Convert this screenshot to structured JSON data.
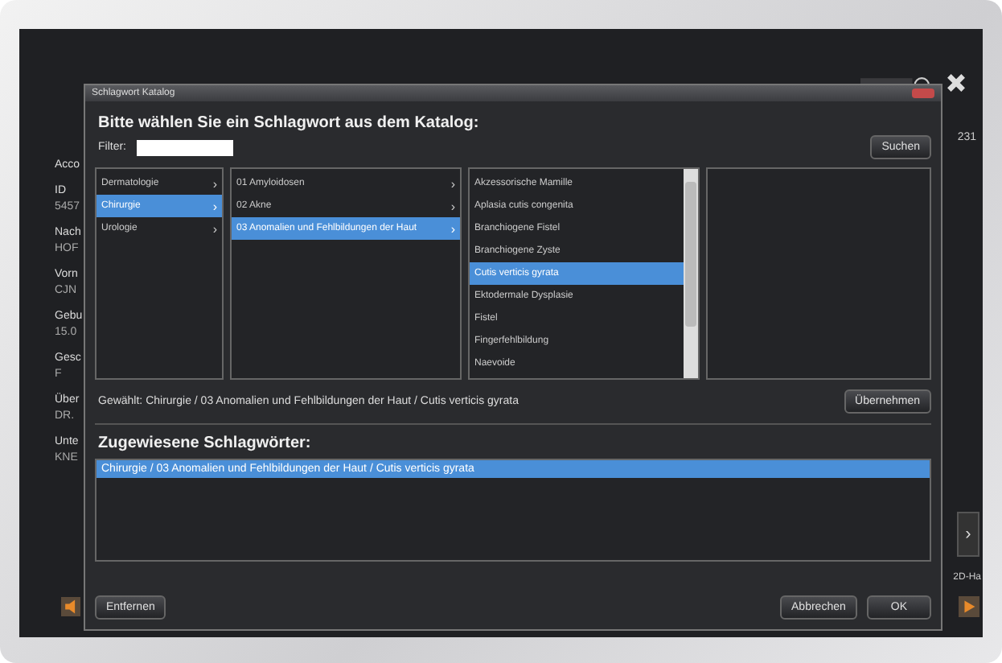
{
  "background_app": {
    "labels": [
      "Acco",
      "ID",
      "5457",
      "Nach",
      "HOF",
      "Vorn",
      "CJN",
      "Gebu",
      "15.0",
      "Gesc",
      "F",
      "Über",
      "DR.",
      "Unte",
      "KNE"
    ],
    "right_text": "231",
    "side_button": "›",
    "corner_text": "2D-Ha"
  },
  "dialog": {
    "title": "Schlagwort Katalog",
    "heading": "Bitte wählen Sie ein Schlagwort aus dem Katalog:",
    "filter_label": "Filter:",
    "search_button": "Suchen",
    "lists": [
      {
        "items": [
          {
            "label": "Dermatologie",
            "arrow": "›",
            "selected": false
          },
          {
            "label": "Chirurgie",
            "arrow": "›",
            "selected": true
          },
          {
            "label": "Urologie",
            "arrow": "›",
            "selected": false
          }
        ]
      },
      {
        "items": [
          {
            "label": "01 Amyloidosen",
            "arrow": "›",
            "selected": false
          },
          {
            "label": "02 Akne",
            "arrow": "›",
            "selected": false
          },
          {
            "label": "03 Anomalien und Fehlbildungen der Haut",
            "arrow": "›",
            "selected": true
          }
        ]
      },
      {
        "scrollbar": true,
        "items": [
          {
            "label": "Akzessorische Mamille",
            "selected": false
          },
          {
            "label": "Aplasia cutis congenita",
            "selected": false
          },
          {
            "label": "Branchiogene Fistel",
            "selected": false
          },
          {
            "label": "Branchiogene Zyste",
            "selected": false
          },
          {
            "label": "Cutis verticis gyrata",
            "selected": true
          },
          {
            "label": "Ektodermale Dysplasie",
            "selected": false
          },
          {
            "label": "Fistel",
            "selected": false
          },
          {
            "label": "Fingerfehlbildung",
            "selected": false
          },
          {
            "label": "Naevoide",
            "selected": false
          }
        ]
      },
      {
        "scrollbar": false
      }
    ],
    "chosen_label": "Gewählt:",
    "chosen_value": "Chirurgie / 03 Anomalien und Fehlbildungen der Haut / Cutis verticis gyrata",
    "apply_button": "Übernehmen",
    "assigned_heading": "Zugewiesene Schlagwörter:",
    "assigned": [
      {
        "label": "Chirurgie / 03 Anomalien und Fehlbildungen der Haut / Cutis verticis gyrata",
        "selected": true
      }
    ],
    "remove_button": "Entfernen",
    "cancel_button": "Abbrechen",
    "ok_button": "OK"
  }
}
